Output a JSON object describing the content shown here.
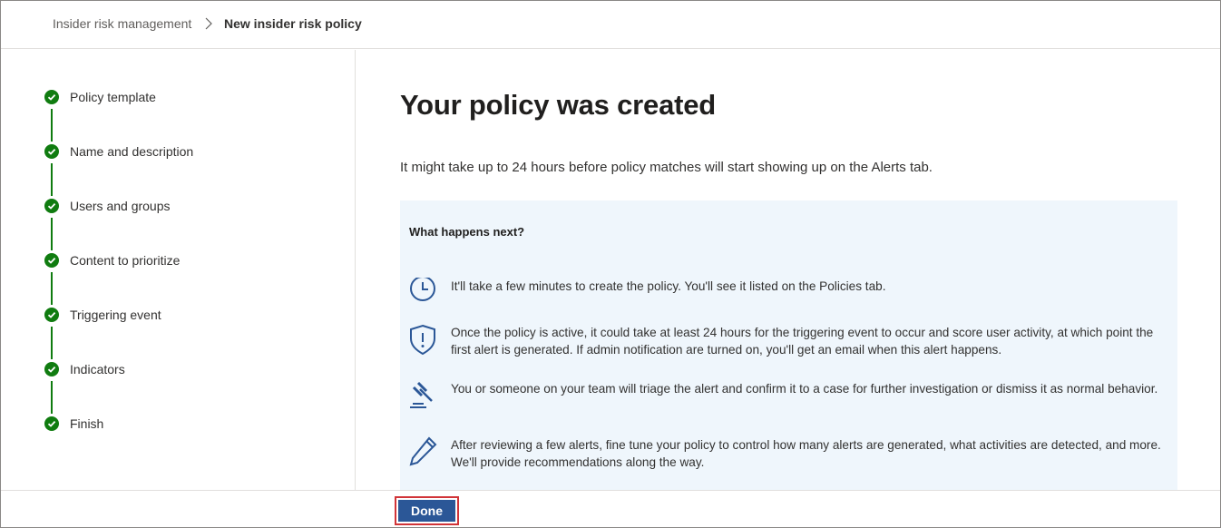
{
  "breadcrumb": {
    "root": "Insider risk management",
    "current": "New insider risk policy"
  },
  "steps": [
    {
      "label": "Policy template",
      "status": "complete"
    },
    {
      "label": "Name and description",
      "status": "complete"
    },
    {
      "label": "Users and groups",
      "status": "complete"
    },
    {
      "label": "Content to prioritize",
      "status": "complete"
    },
    {
      "label": "Triggering event",
      "status": "complete"
    },
    {
      "label": "Indicators",
      "status": "complete"
    },
    {
      "label": "Finish",
      "status": "complete"
    }
  ],
  "main": {
    "title": "Your policy was created",
    "subtitle": "It might take up to 24 hours before policy matches will start showing up on the Alerts tab.",
    "next": {
      "heading": "What happens next?",
      "items": [
        {
          "icon": "clock-icon",
          "text": "It'll take a few minutes to create the policy. You'll see it listed on the Policies tab."
        },
        {
          "icon": "shield-alert-icon",
          "text": "Once the policy is active, it could take at least 24 hours for the triggering event to occur and score user activity, at which point the first alert is generated. If admin notification are turned on, you'll get an email when this alert happens."
        },
        {
          "icon": "gavel-icon",
          "text": "You or someone on your team will triage the alert and confirm it to a case for further investigation or dismiss it as normal behavior."
        },
        {
          "icon": "pencil-icon",
          "text": "After reviewing a few alerts, fine tune your policy to control how many alerts are generated, what activities are detected, and more. We'll provide recommendations along the way."
        }
      ]
    }
  },
  "footer": {
    "done_label": "Done"
  },
  "colors": {
    "step_complete": "#107c10",
    "panel_bg": "#eff6fc",
    "icon_blue": "#2b5797",
    "primary_button": "#2b5797",
    "highlight_outline": "#d13438"
  }
}
